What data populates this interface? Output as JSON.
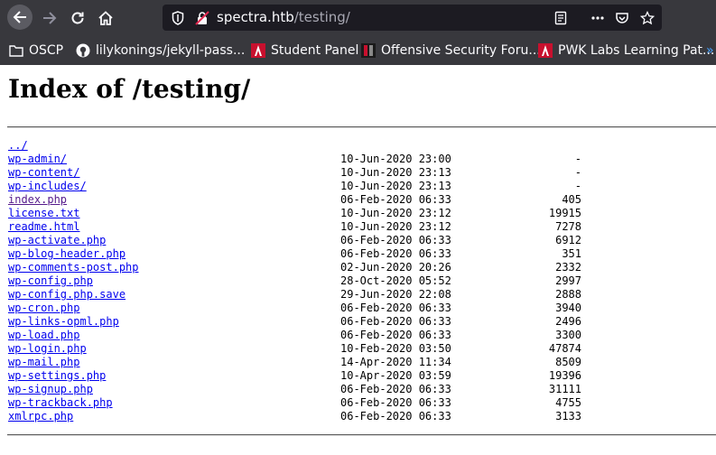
{
  "browser": {
    "url_host": "spectra.htb",
    "url_path": "/testing/"
  },
  "bookmarks": [
    {
      "label": "OSCP",
      "icon": "folder-icon"
    },
    {
      "label": "lilykonings/jekyll-pass...",
      "icon": "github-icon"
    },
    {
      "label": "Student Panel",
      "icon": "offsec-icon"
    },
    {
      "label": "Offensive Security Foru...",
      "icon": "forum-icon"
    },
    {
      "label": "PWK Labs Learning Pat...",
      "icon": "offsec-icon"
    }
  ],
  "page": {
    "heading": "Index of /testing/"
  },
  "listing": [
    {
      "name": "../",
      "date": "",
      "size": ""
    },
    {
      "name": "wp-admin/",
      "date": "10-Jun-2020 23:00",
      "size": "-"
    },
    {
      "name": "wp-content/",
      "date": "10-Jun-2020 23:13",
      "size": "-"
    },
    {
      "name": "wp-includes/",
      "date": "10-Jun-2020 23:13",
      "size": "-"
    },
    {
      "name": "index.php",
      "date": "06-Feb-2020 06:33",
      "size": "405"
    },
    {
      "name": "license.txt",
      "date": "10-Jun-2020 23:12",
      "size": "19915"
    },
    {
      "name": "readme.html",
      "date": "10-Jun-2020 23:12",
      "size": "7278"
    },
    {
      "name": "wp-activate.php",
      "date": "06-Feb-2020 06:33",
      "size": "6912"
    },
    {
      "name": "wp-blog-header.php",
      "date": "06-Feb-2020 06:33",
      "size": "351"
    },
    {
      "name": "wp-comments-post.php",
      "date": "02-Jun-2020 20:26",
      "size": "2332"
    },
    {
      "name": "wp-config.php",
      "date": "28-Oct-2020 05:52",
      "size": "2997"
    },
    {
      "name": "wp-config.php.save",
      "date": "29-Jun-2020 22:08",
      "size": "2888"
    },
    {
      "name": "wp-cron.php",
      "date": "06-Feb-2020 06:33",
      "size": "3940"
    },
    {
      "name": "wp-links-opml.php",
      "date": "06-Feb-2020 06:33",
      "size": "2496"
    },
    {
      "name": "wp-load.php",
      "date": "06-Feb-2020 06:33",
      "size": "3300"
    },
    {
      "name": "wp-login.php",
      "date": "10-Feb-2020 03:50",
      "size": "47874"
    },
    {
      "name": "wp-mail.php",
      "date": "14-Apr-2020 11:34",
      "size": "8509"
    },
    {
      "name": "wp-settings.php",
      "date": "10-Apr-2020 03:59",
      "size": "19396"
    },
    {
      "name": "wp-signup.php",
      "date": "06-Feb-2020 06:33",
      "size": "31111"
    },
    {
      "name": "wp-trackback.php",
      "date": "06-Feb-2020 06:33",
      "size": "4755"
    },
    {
      "name": "xmlrpc.php",
      "date": "06-Feb-2020 06:33",
      "size": "3133"
    }
  ],
  "colors": {
    "toolbar_bg": "#38383d",
    "urlbar_bg": "#1c1b22",
    "link": "#0000ee",
    "visited_link": "#551a8b"
  }
}
